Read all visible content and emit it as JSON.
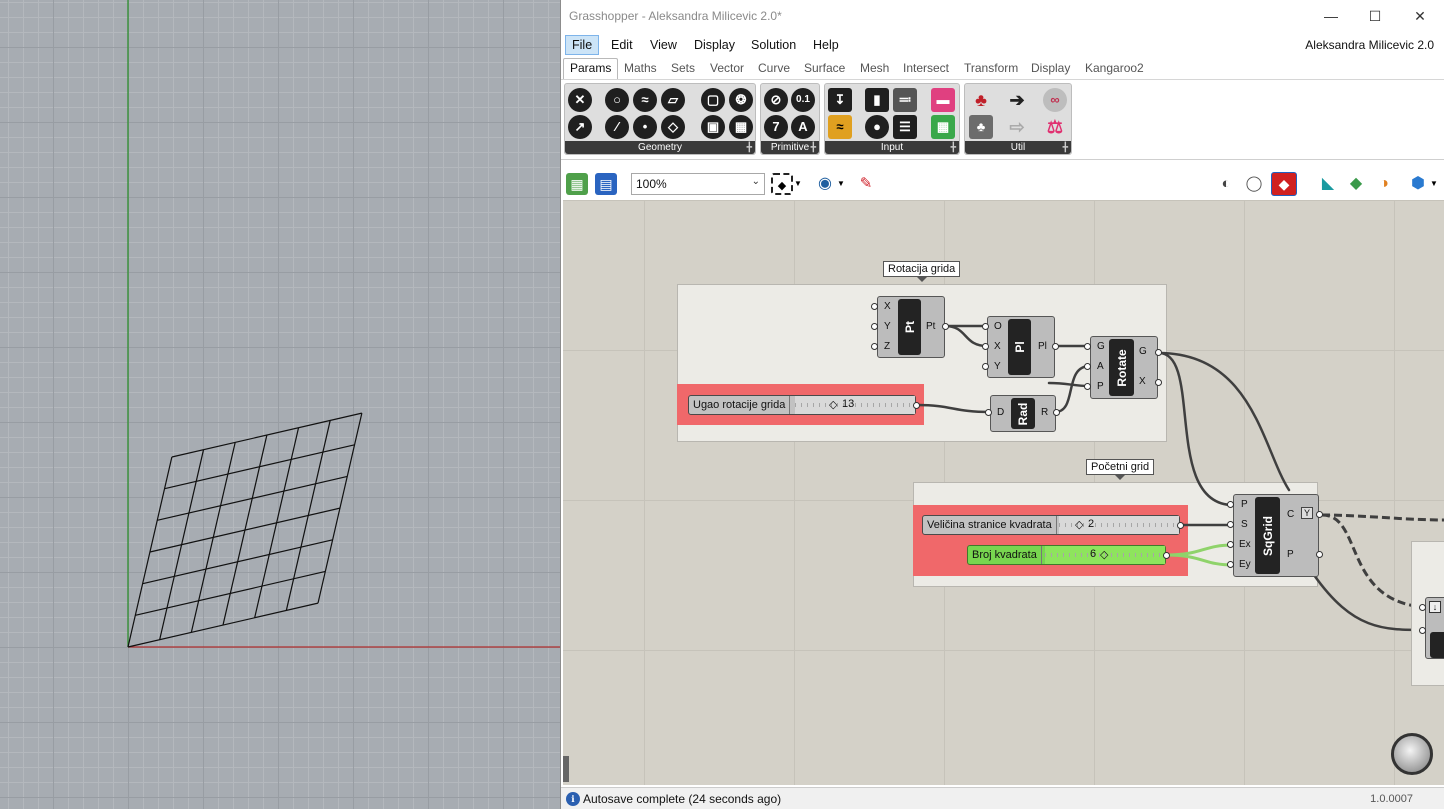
{
  "window": {
    "title": "Grasshopper - Aleksandra Milicevic 2.0*",
    "document": "Aleksandra Milicevic 2.0"
  },
  "menu": [
    "File",
    "Edit",
    "View",
    "Display",
    "Solution",
    "Help"
  ],
  "tabs": [
    "Params",
    "Maths",
    "Sets",
    "Vector",
    "Curve",
    "Surface",
    "Mesh",
    "Intersect",
    "Transform",
    "Display",
    "Kangaroo2"
  ],
  "ribbon_groups": [
    "Geometry",
    "Primitive",
    "Input",
    "Util"
  ],
  "ribbon_icon_glyphs": {
    "primitive_num": "0.1",
    "primitive_int": "7",
    "primitive_text": "A"
  },
  "toolbar": {
    "zoom": "100%"
  },
  "canvas": {
    "groups": [
      {
        "label": "Rotacija grida"
      },
      {
        "label": "Početni grid"
      }
    ],
    "components": {
      "pt": {
        "name": "Pt",
        "inputs": [
          "X",
          "Y",
          "Z"
        ],
        "outputs": [
          "Pt"
        ]
      },
      "pl": {
        "name": "Pl",
        "inputs": [
          "O",
          "X",
          "Y"
        ],
        "outputs": [
          "Pl"
        ]
      },
      "rotate": {
        "name": "Rotate",
        "inputs": [
          "G",
          "A",
          "P"
        ],
        "outputs": [
          "G",
          "X"
        ]
      },
      "rad": {
        "name": "Rad",
        "inputs": [
          "D"
        ],
        "outputs": [
          "R"
        ]
      },
      "sqgrid": {
        "name": "SqGrid",
        "inputs": [
          "P",
          "S",
          "Ex",
          "Ey"
        ],
        "outputs": [
          "C",
          "P"
        ],
        "flag": "Y"
      }
    },
    "sliders": {
      "angle": {
        "label": "Ugao rotacije grida",
        "value": "13",
        "fraction": 0.3
      },
      "size": {
        "label": "Veličina stranice kvadrata",
        "value": "2",
        "fraction": 0.15
      },
      "count": {
        "label": "Broj kvadrata",
        "value": "6",
        "fraction": 0.5
      }
    }
  },
  "status": {
    "message": "Autosave complete (24 seconds ago)",
    "version": "1.0.0007"
  },
  "colors": {
    "slider_area": "#f0686a",
    "active_slider": "#78d64f",
    "canvas_bg": "#d4d1c8",
    "x_axis": "#b03030",
    "y_axis": "#2f8f2f"
  }
}
